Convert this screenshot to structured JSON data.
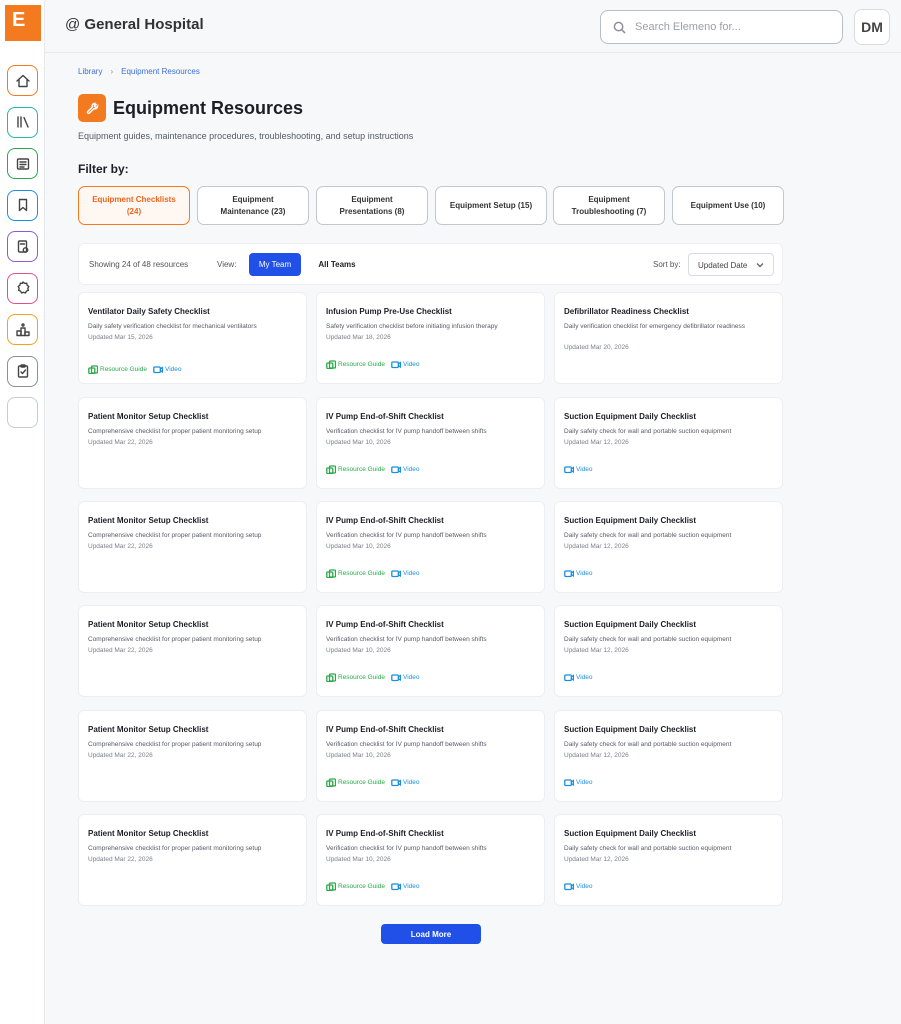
{
  "app": {
    "logo_letter": "E",
    "org_prefix": "@",
    "org_name": "General Hospital"
  },
  "search": {
    "placeholder": "Search Elemeno for..."
  },
  "user": {
    "initials": "DM"
  },
  "breadcrumb": {
    "root": "Library",
    "current": "Equipment Resources"
  },
  "page": {
    "title": "Equipment Resources",
    "subtitle": "Equipment guides, maintenance procedures, troubleshooting, and setup instructions",
    "filter_label": "Filter by:"
  },
  "filters": [
    {
      "line1": "Equipment Checklists",
      "line2": "(24)",
      "active": true
    },
    {
      "line1": "Equipment",
      "line2": "Maintenance (23)",
      "active": false
    },
    {
      "line1": "Equipment",
      "line2": "Presentations (8)",
      "active": false
    },
    {
      "line1": "Equipment Setup (15)",
      "line2": "",
      "active": false
    },
    {
      "line1": "Equipment",
      "line2": "Troubleshooting (7)",
      "active": false
    },
    {
      "line1": "Equipment Use (10)",
      "line2": "",
      "active": false
    }
  ],
  "toolbar": {
    "showing": "Showing 24 of 48 resources",
    "view_label": "View:",
    "my_team": "My Team",
    "all_teams": "All Teams",
    "sort_label": "Sort by:",
    "sort_value": "Updated Date"
  },
  "link_labels": {
    "guide": "Resource Guide",
    "video": "Video"
  },
  "cards": [
    {
      "title": "Ventilator Daily Safety Checklist",
      "desc": "Daily safety verification checklist for mechanical ventilators",
      "date": "Updated Mar 15, 2026",
      "guide": true,
      "video": true
    },
    {
      "title": "Infusion Pump Pre-Use Checklist",
      "desc": "Safety verification checklist before initiating infusion therapy",
      "date": "Updated Mar 18, 2026",
      "guide": true,
      "video": true
    },
    {
      "title": "Defibrillator Readiness Checklist",
      "desc": "Daily verification checklist for emergency defibrillator readiness",
      "date": "Updated Mar 20, 2026",
      "guide": false,
      "video": false
    },
    {
      "title": "Patient Monitor Setup Checklist",
      "desc": "Comprehensive checklist for proper patient monitoring setup",
      "date": "Updated Mar 22, 2026",
      "guide": false,
      "video": false
    },
    {
      "title": "IV Pump End-of-Shift Checklist",
      "desc": "Verification checklist for IV pump handoff between shifts",
      "date": "Updated Mar 10, 2026",
      "guide": true,
      "video": true
    },
    {
      "title": "Suction Equipment Daily Checklist",
      "desc": "Daily safety check for wall and portable suction equipment",
      "date": "Updated Mar 12, 2026",
      "guide": false,
      "video": true
    },
    {
      "title": "Patient Monitor Setup Checklist",
      "desc": "Comprehensive checklist for proper patient monitoring setup",
      "date": "Updated Mar 22, 2026",
      "guide": false,
      "video": false
    },
    {
      "title": "IV Pump End-of-Shift Checklist",
      "desc": "Verification checklist for IV pump handoff between shifts",
      "date": "Updated Mar 10, 2026",
      "guide": true,
      "video": true
    },
    {
      "title": "Suction Equipment Daily Checklist",
      "desc": "Daily safety check for wall and portable suction equipment",
      "date": "Updated Mar 12, 2026",
      "guide": false,
      "video": true
    },
    {
      "title": "Patient Monitor Setup Checklist",
      "desc": "Comprehensive checklist for proper patient monitoring setup",
      "date": "Updated Mar 22, 2026",
      "guide": false,
      "video": false
    },
    {
      "title": "IV Pump End-of-Shift Checklist",
      "desc": "Verification checklist for IV pump handoff between shifts",
      "date": "Updated Mar 10, 2026",
      "guide": true,
      "video": true
    },
    {
      "title": "Suction Equipment Daily Checklist",
      "desc": "Daily safety check for wall and portable suction equipment",
      "date": "Updated Mar 12, 2026",
      "guide": false,
      "video": true
    },
    {
      "title": "Patient Monitor Setup Checklist",
      "desc": "Comprehensive checklist for proper patient monitoring setup",
      "date": "Updated Mar 22, 2026",
      "guide": false,
      "video": false
    },
    {
      "title": "IV Pump End-of-Shift Checklist",
      "desc": "Verification checklist for IV pump handoff between shifts",
      "date": "Updated Mar 10, 2026",
      "guide": true,
      "video": true
    },
    {
      "title": "Suction Equipment Daily Checklist",
      "desc": "Daily safety check for wall and portable suction equipment",
      "date": "Updated Mar 12, 2026",
      "guide": false,
      "video": true
    },
    {
      "title": "Patient Monitor Setup Checklist",
      "desc": "Comprehensive checklist for proper patient monitoring setup",
      "date": "Updated Mar 22, 2026",
      "guide": false,
      "video": false
    },
    {
      "title": "IV Pump End-of-Shift Checklist",
      "desc": "Verification checklist for IV pump handoff between shifts",
      "date": "Updated Mar 10, 2026",
      "guide": true,
      "video": true
    },
    {
      "title": "Suction Equipment Daily Checklist",
      "desc": "Daily safety check for wall and portable suction equipment",
      "date": "Updated Mar 12, 2026",
      "guide": false,
      "video": true
    }
  ],
  "load_more": "Load More",
  "sidebar": {
    "items": [
      {
        "icon": "home-icon",
        "color": "#f47a20"
      },
      {
        "icon": "library-icon",
        "color": "#20b8a8"
      },
      {
        "icon": "news-icon",
        "color": "#2aa84a"
      },
      {
        "icon": "bookmark-icon",
        "color": "#1a8ee0"
      },
      {
        "icon": "document-search-icon",
        "color": "#8a5cd6"
      },
      {
        "icon": "badge-icon",
        "color": "#e0508a"
      },
      {
        "icon": "leaderboard-icon",
        "color": "#f4a020"
      },
      {
        "icon": "clipboard-check-icon",
        "color": "#8a8f99"
      },
      {
        "icon": "blank-icon",
        "color": "#c8cbd2"
      },
      {
        "icon": "blank-icon",
        "color": "#ffffff"
      }
    ]
  },
  "colors": {
    "brand": "#f47a20",
    "primary": "#2150e8",
    "guide": "#2aa84a",
    "video": "#1a8ee0"
  }
}
